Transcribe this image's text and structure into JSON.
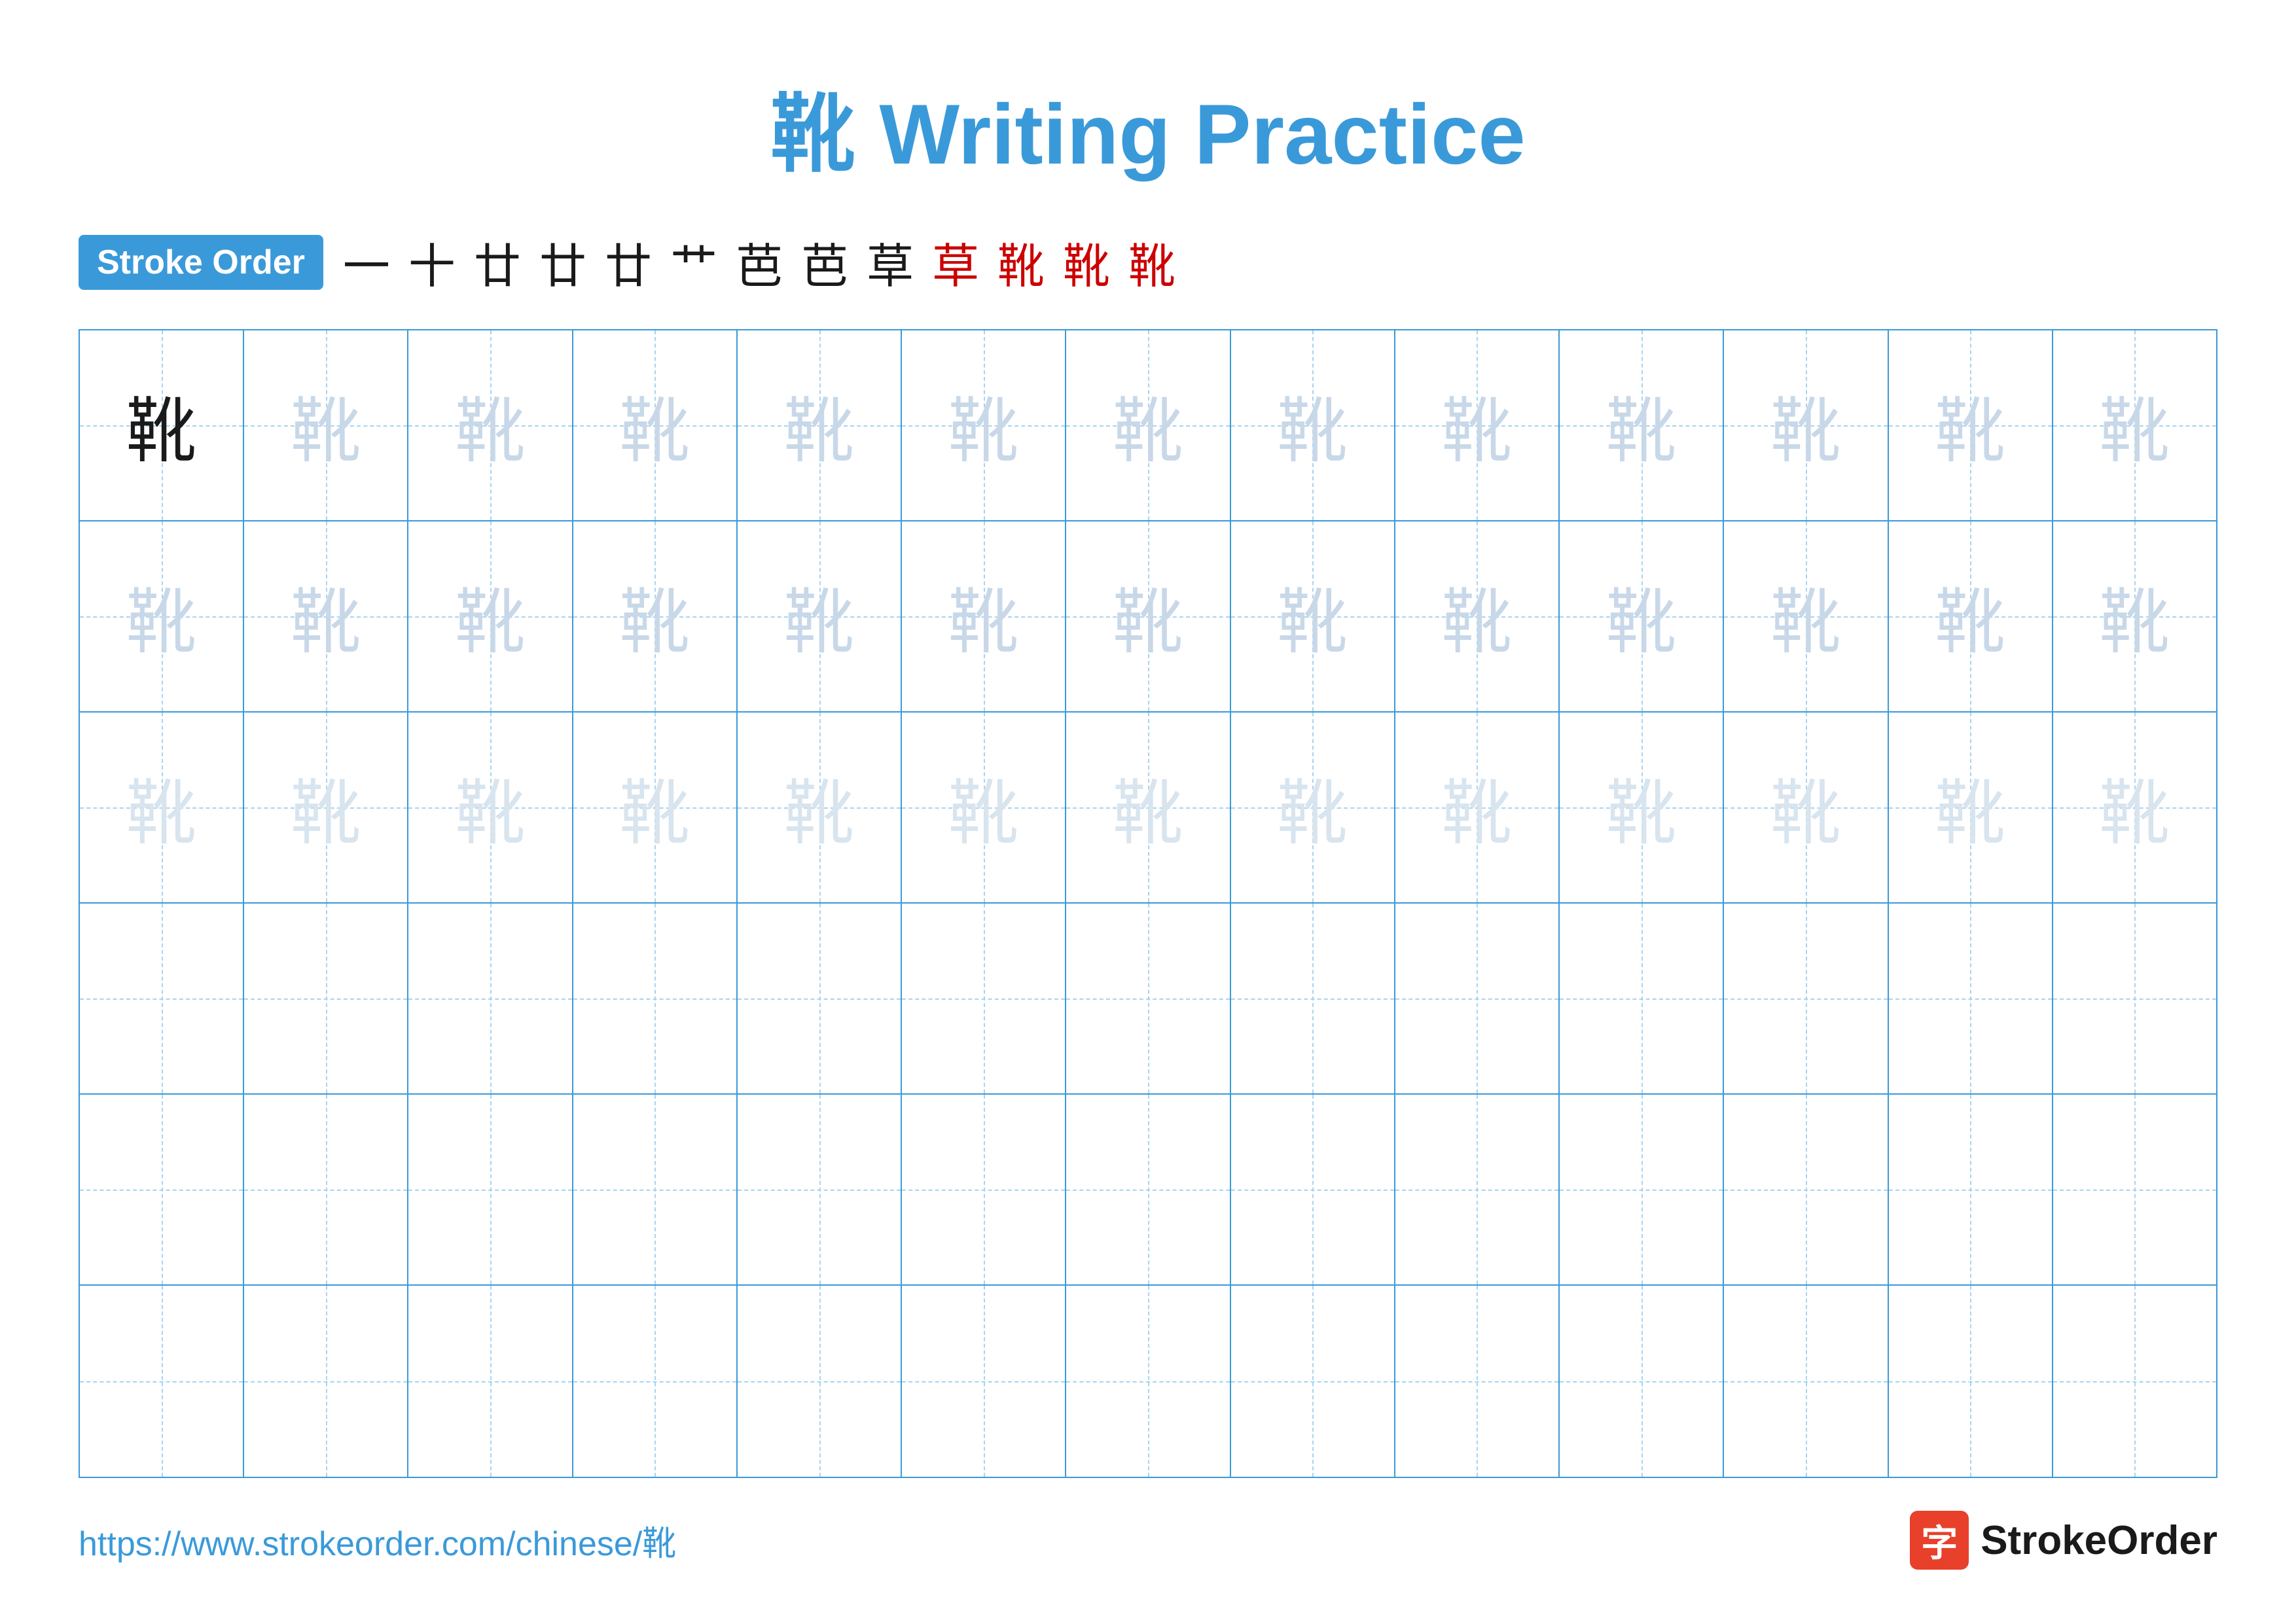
{
  "title": {
    "char": "靴",
    "text": " Writing Practice"
  },
  "stroke_order": {
    "badge_label": "Stroke Order",
    "strokes": [
      "一",
      "十",
      "廿",
      "廿",
      "廿",
      "艹",
      "芭",
      "芭",
      "草",
      "草",
      "靴",
      "靴",
      "靴"
    ]
  },
  "grid": {
    "rows": 6,
    "cols": 13,
    "char": "靴",
    "row1_type": "dark_then_light1",
    "row2_type": "light1",
    "row3_type": "light2",
    "row4_type": "empty",
    "row5_type": "empty",
    "row6_type": "empty"
  },
  "footer": {
    "url": "https://www.strokeorder.com/chinese/靴",
    "logo_text": "StrokeOrder",
    "logo_icon": "字"
  }
}
